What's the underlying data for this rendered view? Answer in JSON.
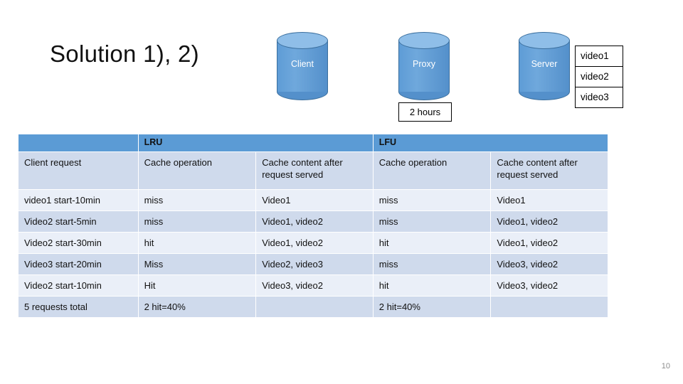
{
  "slide": {
    "title": "Solution 1), 2)",
    "page_number": "10"
  },
  "diagram": {
    "nodes": [
      {
        "id": "client",
        "label": "Client",
        "icon": "cylinder-icon"
      },
      {
        "id": "proxy",
        "label": "Proxy",
        "icon": "cylinder-icon"
      },
      {
        "id": "server",
        "label": "Server",
        "icon": "cylinder-icon"
      }
    ],
    "proxy_cache_ttl": "2 hours",
    "server_videos": [
      "video1",
      "video2",
      "video3"
    ],
    "colors": {
      "cylinder_body": "#5B9BD5",
      "cylinder_top": "#8FBEE8",
      "cylinder_outline": "#3B6F9E"
    }
  },
  "table": {
    "group_headers": {
      "request_col": "",
      "lru": "LRU",
      "lfu": "LFU"
    },
    "sub_headers": {
      "client_request": "Client request",
      "lru_operation": "Cache operation",
      "lru_content": "Cache content after request served",
      "lfu_operation": "Cache operation",
      "lfu_content": "Cache content after request served"
    },
    "rows": [
      {
        "request": "video1 start-10min",
        "lru_op": "miss",
        "lru_content": "Video1",
        "lfu_op": "miss",
        "lfu_content": "Video1"
      },
      {
        "request": "Video2 start-5min",
        "lru_op": "miss",
        "lru_content": "Video1, video2",
        "lfu_op": "miss",
        "lfu_content": "Video1, video2"
      },
      {
        "request": "Video2 start-30min",
        "lru_op": "hit",
        "lru_content": "Video1, video2",
        "lfu_op": "hit",
        "lfu_content": "Video1, video2"
      },
      {
        "request": "Video3 start-20min",
        "lru_op": "Miss",
        "lru_content": "Video2, video3",
        "lfu_op": "miss",
        "lfu_content": "Video3, video2"
      },
      {
        "request": "Video2 start-10min",
        "lru_op": "Hit",
        "lru_content": "Video3, video2",
        "lfu_op": "hit",
        "lfu_content": "Video3, video2"
      },
      {
        "request": "5 requests total",
        "lru_op": "2 hit=40%",
        "lru_content": "",
        "lfu_op": "2 hit=40%",
        "lfu_content": ""
      }
    ],
    "colors": {
      "header": "#5B9BD5",
      "row_light": "#EAEFF8",
      "row_dark": "#CFDAEC"
    }
  }
}
